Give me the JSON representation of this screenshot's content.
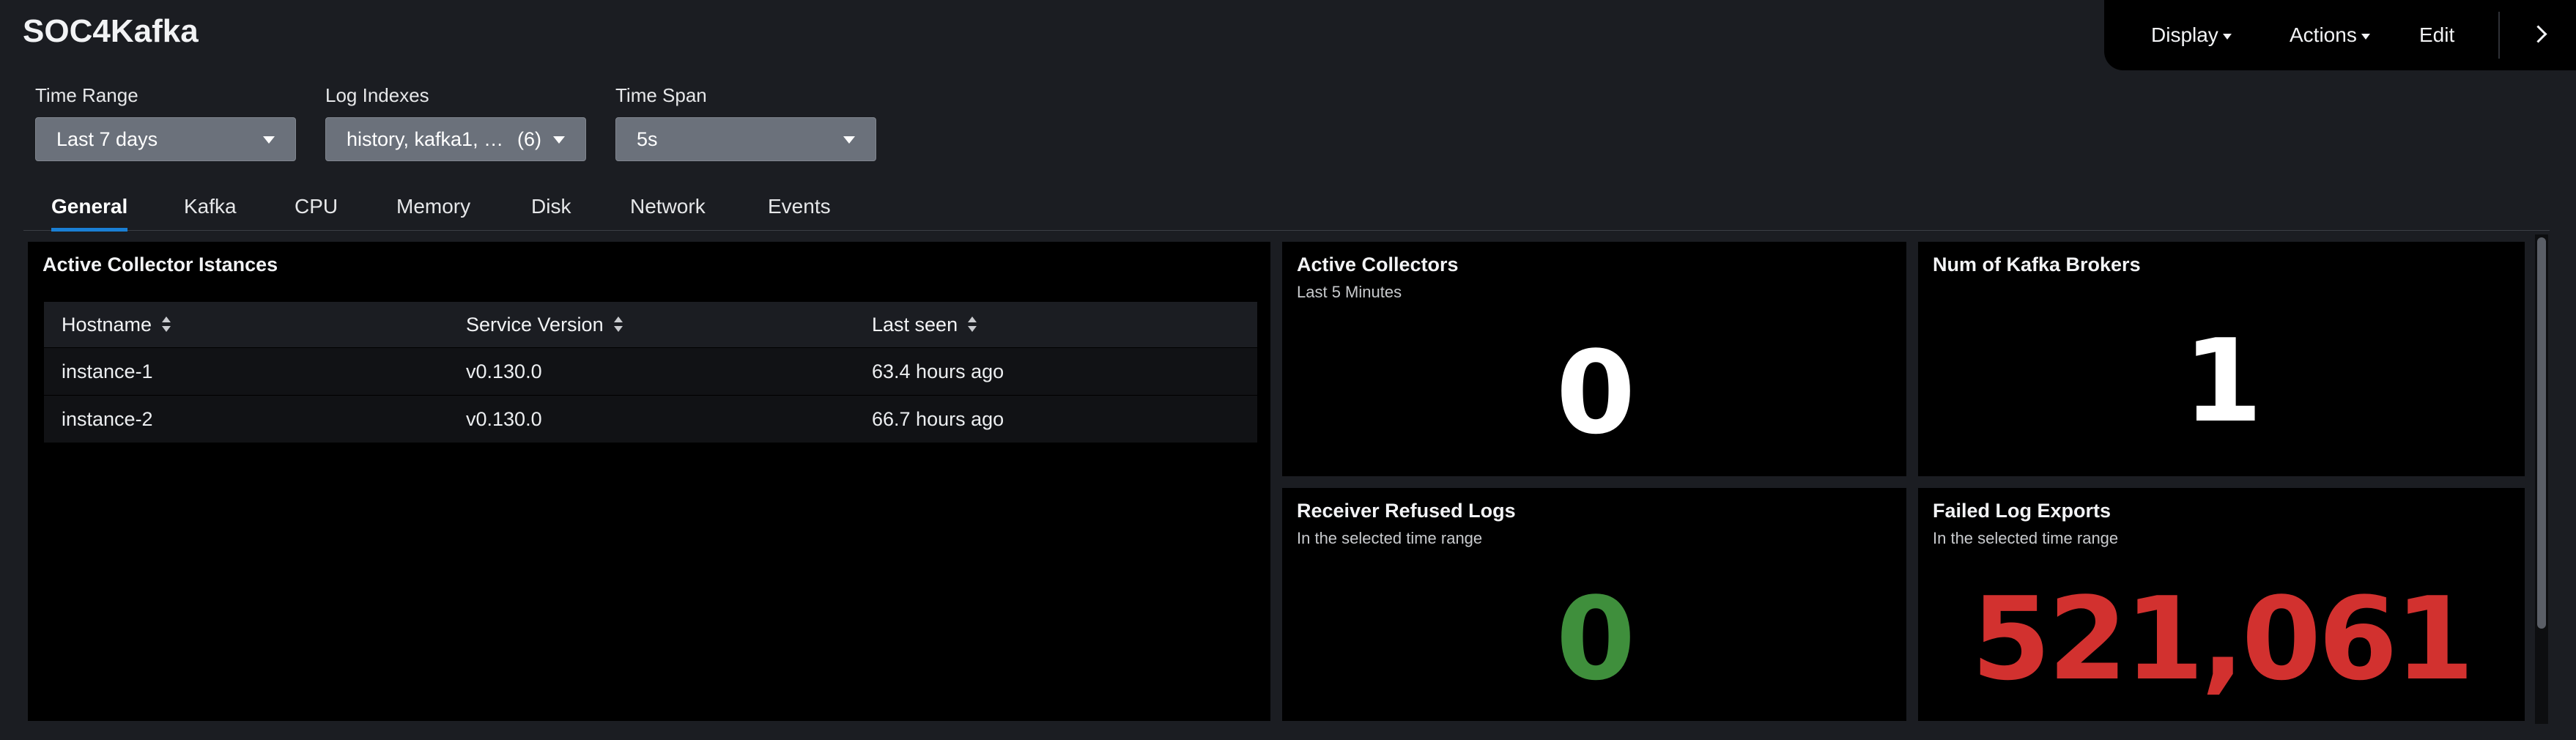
{
  "app": {
    "title": "SOC4Kafka"
  },
  "toolbar": {
    "display": "Display",
    "actions": "Actions",
    "edit": "Edit"
  },
  "filters": {
    "time_range": {
      "label": "Time Range",
      "value": "Last 7 days"
    },
    "log_indexes": {
      "label": "Log Indexes",
      "value": "history, kafka1, ka...",
      "count": "(6)"
    },
    "time_span": {
      "label": "Time Span",
      "value": "5s"
    }
  },
  "tabs": [
    {
      "label": "General",
      "active": true
    },
    {
      "label": "Kafka"
    },
    {
      "label": "CPU"
    },
    {
      "label": "Memory"
    },
    {
      "label": "Disk"
    },
    {
      "label": "Network"
    },
    {
      "label": "Events"
    }
  ],
  "panels": {
    "collectors_table": {
      "title": "Active Collector Istances",
      "columns": [
        "Hostname",
        "Service Version",
        "Last seen"
      ],
      "rows": [
        [
          "instance-1",
          "v0.130.0",
          "63.4 hours ago"
        ],
        [
          "instance-2",
          "v0.130.0",
          "66.7 hours ago"
        ]
      ]
    },
    "active_collectors": {
      "title": "Active Collectors",
      "subtitle": "Last 5 Minutes",
      "value": "0",
      "color": "#ffffff"
    },
    "kafka_brokers": {
      "title": "Num of Kafka Brokers",
      "value": "1",
      "color": "#ffffff"
    },
    "receiver_refused": {
      "title": "Receiver Refused Logs",
      "subtitle": "In the selected time range",
      "value": "0",
      "color": "#3f8f3c"
    },
    "failed_exports": {
      "title": "Failed Log Exports",
      "subtitle": "In the selected time range",
      "value": "521,061",
      "color": "#d2312f"
    }
  }
}
